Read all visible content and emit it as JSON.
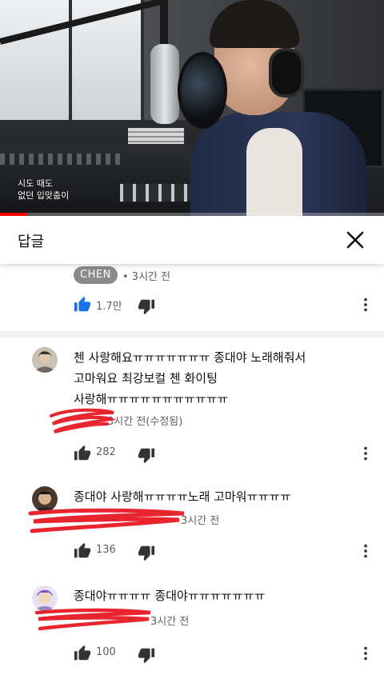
{
  "video": {
    "caption_line1": "시도 때도",
    "caption_line2": "없던 입맞춤이",
    "progress_fraction": 0.07,
    "progress_color": "#ff0000"
  },
  "reply_panel": {
    "title": "답글",
    "close_icon": "close-icon"
  },
  "parent_comment": {
    "author_badge": "CHEN",
    "time": "• 3시간 전",
    "likes": "1.7만",
    "like_active_color": "#1a73e8"
  },
  "replies": [
    {
      "text_lines": [
        "첸 사랑해요ㅠㅠㅠㅠㅠㅠㅠ 종대야 노래해줘서",
        "고마워요 최강보컬 첸 화이팅",
        "사랑해ㅠㅠㅠㅠㅠㅠㅠㅠㅠㅠㅠ"
      ],
      "time": "3시간 전(수정됨)",
      "likes": "282"
    },
    {
      "text_lines": [
        "종대야 사랑해ㅠㅠㅠㅠ노래 고마워ㅠㅠㅠㅠ"
      ],
      "time": "3시간 전",
      "likes": "136"
    },
    {
      "text_lines": [
        "종대야ㅠㅠㅠㅠ 종대야ㅠㅠㅠㅠㅠㅠㅠ"
      ],
      "time": "3시간 전",
      "likes": "100"
    }
  ],
  "icons": {
    "like": "thumbs-up-icon",
    "dislike": "thumbs-down-icon",
    "more": "more-vertical-icon"
  },
  "colors": {
    "scribble_red": "#e8242f",
    "secondary_text": "#606060",
    "badge_bg": "#8a8a8a"
  }
}
